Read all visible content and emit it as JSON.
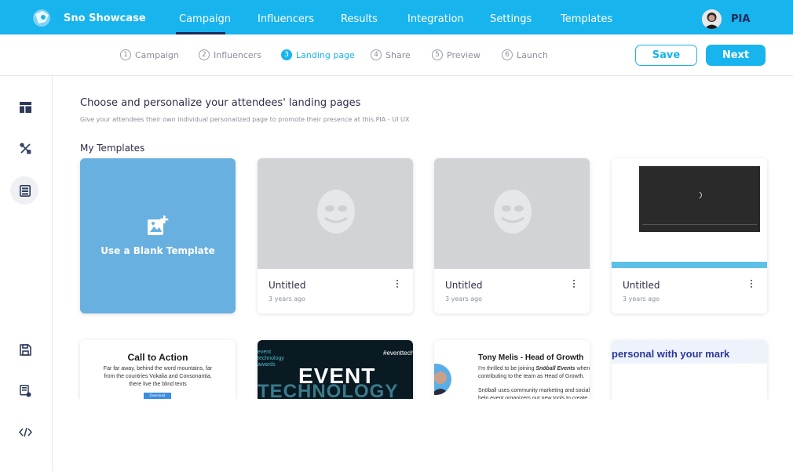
{
  "app": {
    "brand": "Sno Showcase"
  },
  "nav": {
    "items": [
      "Campaign",
      "Influencers",
      "Results",
      "Integration",
      "Settings",
      "Templates"
    ],
    "active": "Campaign"
  },
  "user": {
    "name": "PIA"
  },
  "steps": [
    {
      "num": "1",
      "label": "Campaign"
    },
    {
      "num": "2",
      "label": "Influencers"
    },
    {
      "num": "3",
      "label": "Landing page"
    },
    {
      "num": "4",
      "label": "Share"
    },
    {
      "num": "5",
      "label": "Preview"
    },
    {
      "num": "6",
      "label": "Launch"
    }
  ],
  "active_step": "Landing page",
  "actions": {
    "save": "Save",
    "next": "Next"
  },
  "page": {
    "heading": "Choose and personalize your attendees' landing pages",
    "subheading": "Give your attendees their own individual personalized page to promote their presence at this.PIA - UI UX",
    "section_title": "My Templates",
    "blank_template": "Use a Blank Template"
  },
  "templates": [
    {
      "title": "Untitled",
      "date": "3 years ago"
    },
    {
      "title": "Untitled",
      "date": "3 years ago"
    },
    {
      "title": "Untitled",
      "date": "3 years ago"
    }
  ],
  "previews": {
    "cta": {
      "title": "Call to Action",
      "body": "Far far away, behind the word mountains, far from the countries Vokalia and Consonantia, there live the blind texts",
      "button": "Download"
    },
    "event": {
      "tag": "#eventtech",
      "small": "event\ntechnology\nawards",
      "big": "EVENT",
      "tech": "TECHNOLOGY"
    },
    "tony": {
      "title": "Tony Melis - Head of Growth",
      "line1": "I'm thrilled to be joining",
      "line1_em": "Snöball Events",
      "line1_end": "where",
      "line2": "contributing to the team as Head of Growth.",
      "line3": "Snöball uses community marketing and social",
      "line4": "help event organizers out new tools to create"
    },
    "personal": {
      "text": "personal with your mark"
    }
  },
  "colors": {
    "accent": "#18b4ee",
    "navy": "#1a2a5a",
    "blank_card": "#68b0e0",
    "placeholder": "#d2d3d7"
  }
}
